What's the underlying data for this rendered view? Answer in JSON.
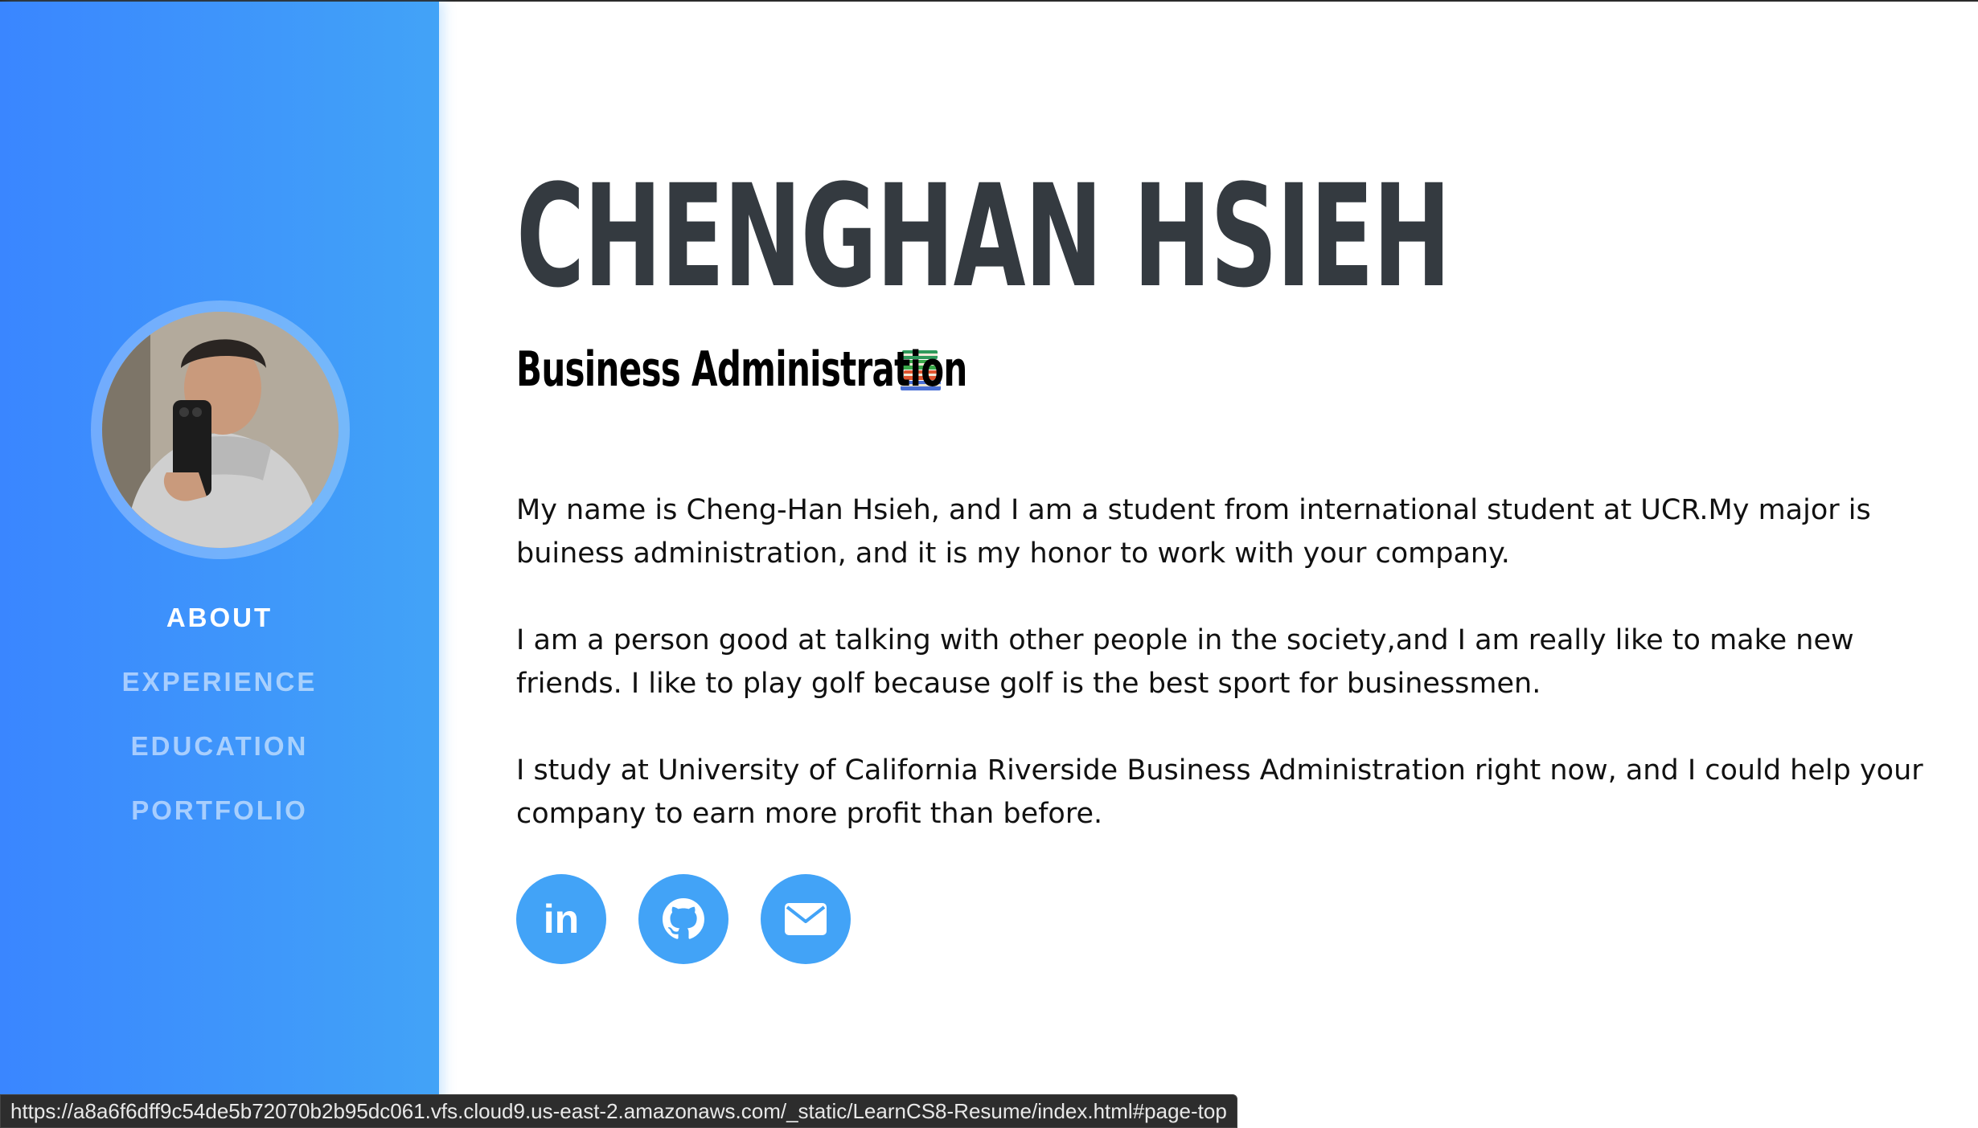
{
  "sidebar": {
    "avatar_alt": "profile photo",
    "nav": [
      {
        "label": "ABOUT",
        "active": true
      },
      {
        "label": "EXPERIENCE",
        "active": false
      },
      {
        "label": "EDUCATION",
        "active": false
      },
      {
        "label": "PORTFOLIO",
        "active": false
      }
    ]
  },
  "main": {
    "name": "CHENGHAN HSIEH",
    "subtitle": "Business Administration",
    "subtitle_icon": "books-emoji-icon",
    "paragraphs": [
      "My name is Cheng-Han Hsieh, and I am a student from international student at UCR.My major is buiness administration, and it is my honor to work with your company.",
      "I am a person good at talking with other people in the society,and I am really like to make new friends. I like to play golf because golf is the best sport for businessmen.",
      "I study at University of California Riverside Business Administration right now, and I could help your company to earn more profit than before."
    ],
    "social": [
      {
        "icon": "linkedin-icon",
        "label": "in"
      },
      {
        "icon": "github-icon"
      },
      {
        "icon": "envelope-icon"
      }
    ]
  },
  "status_url": "https://a8a6f6dff9c54de5b72070b2b95dc061.vfs.cloud9.us-east-2.amazonaws.com/_static/LearnCS8-Resume/index.html#page-top",
  "colors": {
    "sidebar_start": "#3a86ff",
    "sidebar_end": "#42a3f7",
    "accent": "#42a3f7",
    "heading": "#343a40"
  }
}
